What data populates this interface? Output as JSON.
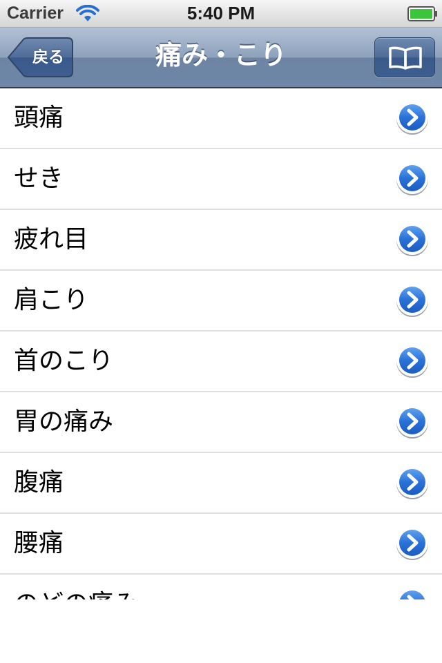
{
  "status_bar": {
    "carrier": "Carrier",
    "time": "5:40 PM",
    "wifi_icon": "wifi-icon",
    "battery_icon": "battery-icon"
  },
  "nav": {
    "back_label": "戻る",
    "title": "痛み・こり",
    "bookmark_icon": "book-icon",
    "bar_color": "#6f87a8"
  },
  "list": {
    "items": [
      {
        "label": "頭痛"
      },
      {
        "label": "せき"
      },
      {
        "label": "疲れ目"
      },
      {
        "label": "肩こり"
      },
      {
        "label": "首のこり"
      },
      {
        "label": "胃の痛み"
      },
      {
        "label": "腹痛"
      },
      {
        "label": "腰痛"
      },
      {
        "label": "のどの痛み"
      }
    ],
    "accessory_icon": "detail-disclosure-icon",
    "accessory_color": "#2a72d8"
  }
}
